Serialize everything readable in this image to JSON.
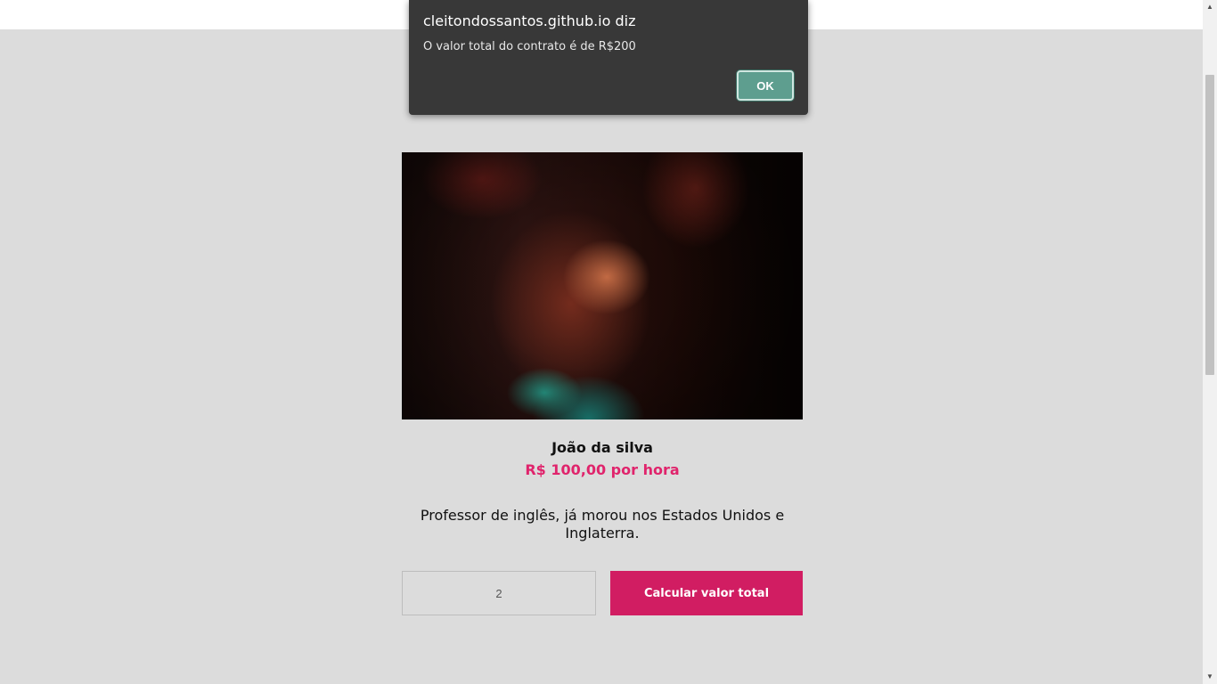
{
  "dialog": {
    "title": "cleitondossantos.github.io diz",
    "message": "O valor total do contrato é de R$200",
    "ok_label": "OK"
  },
  "profile": {
    "name": "João da silva",
    "price": "R$ 100,00 por hora",
    "description": "Professor de inglês, já morou nos Estados Unidos e Inglaterra."
  },
  "form": {
    "hours_value": "2",
    "calculate_label": "Calcular valor total"
  },
  "colors": {
    "accent": "#d11d62",
    "price_text": "#e0246c",
    "background": "#dcdcdc",
    "dialog_bg": "#383838",
    "dialog_button": "#5e9e8f"
  },
  "icons": {
    "scroll_up": "triangle-up-icon",
    "scroll_down": "triangle-down-icon"
  }
}
